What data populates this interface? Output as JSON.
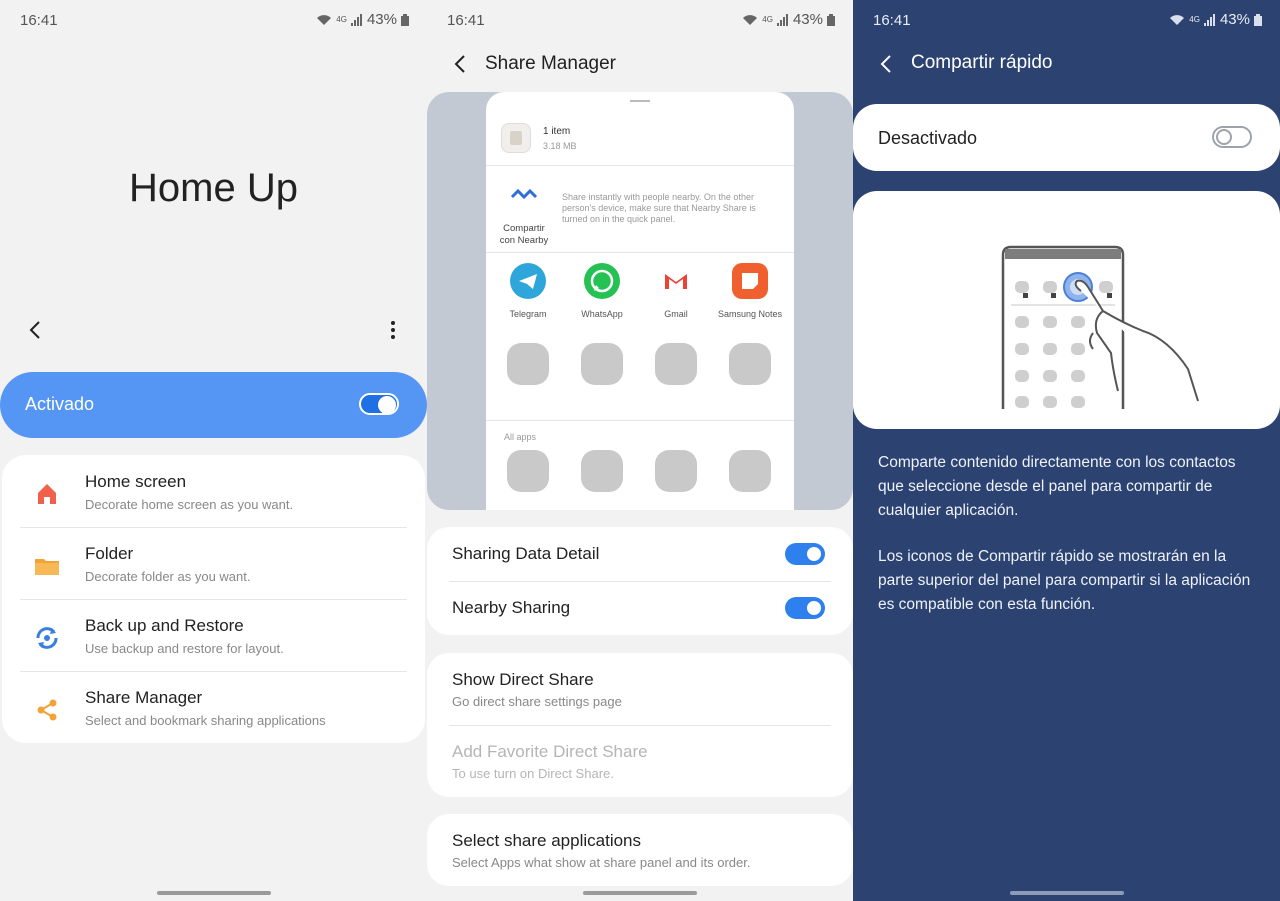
{
  "status": {
    "time": "16:41",
    "network": "4G",
    "battery": "43%"
  },
  "panel1": {
    "title": "Home Up",
    "master_toggle": {
      "label": "Activado",
      "on": true
    },
    "menu": [
      {
        "title": "Home screen",
        "subtitle": "Decorate home screen as you want.",
        "icon": "home-icon",
        "color": "#f0604a"
      },
      {
        "title": "Folder",
        "subtitle": "Decorate folder as you want.",
        "icon": "folder-icon",
        "color": "#f3a23a"
      },
      {
        "title": "Back up and Restore",
        "subtitle": "Use backup and restore for layout.",
        "icon": "backup-restore-icon",
        "color": "#3a7fdc"
      },
      {
        "title": "Share Manager",
        "subtitle": "Select and bookmark sharing applications",
        "icon": "share-icon",
        "color": "#f3a23a"
      }
    ]
  },
  "panel2": {
    "title": "Share Manager",
    "preview": {
      "item_count": "1 item",
      "item_size": "3.18 MB",
      "nearby_label_line1": "Compartir",
      "nearby_label_line2": "con Nearby",
      "nearby_desc": "Share instantly with people nearby. On the other person's device, make sure that Nearby Share is turned on in the quick panel.",
      "apps": [
        {
          "name": "Telegram",
          "icon": "telegram-icon",
          "color": "#2ea6da"
        },
        {
          "name": "WhatsApp",
          "icon": "whatsapp-icon",
          "color": "#25c152"
        },
        {
          "name": "Gmail",
          "icon": "gmail-icon",
          "color": "#ea4335"
        },
        {
          "name": "Samsung Notes",
          "icon": "samsung-notes-icon",
          "color": "#f0602e"
        }
      ],
      "all_apps_label": "All apps"
    },
    "toggles": [
      {
        "label": "Sharing Data Detail",
        "on": true
      },
      {
        "label": "Nearby Sharing",
        "on": true
      }
    ],
    "direct_share": {
      "title": "Show Direct Share",
      "subtitle": "Go direct share settings page",
      "fav_title": "Add Favorite Direct Share",
      "fav_subtitle": "To use turn on Direct Share."
    },
    "select_apps": {
      "title": "Select share applications",
      "subtitle": "Select Apps what show at share panel and its order."
    }
  },
  "panel3": {
    "title": "Compartir rápido",
    "toggle": {
      "label": "Desactivado",
      "on": false
    },
    "desc1": "Comparte contenido directamente con los contactos que seleccione desde el panel para compartir de cualquier aplicación.",
    "desc2": "Los iconos de Compartir rápido se mostrarán en la parte superior del panel para compartir si la aplicación es compatible con esta función.",
    "background_color": "#2c4270"
  }
}
